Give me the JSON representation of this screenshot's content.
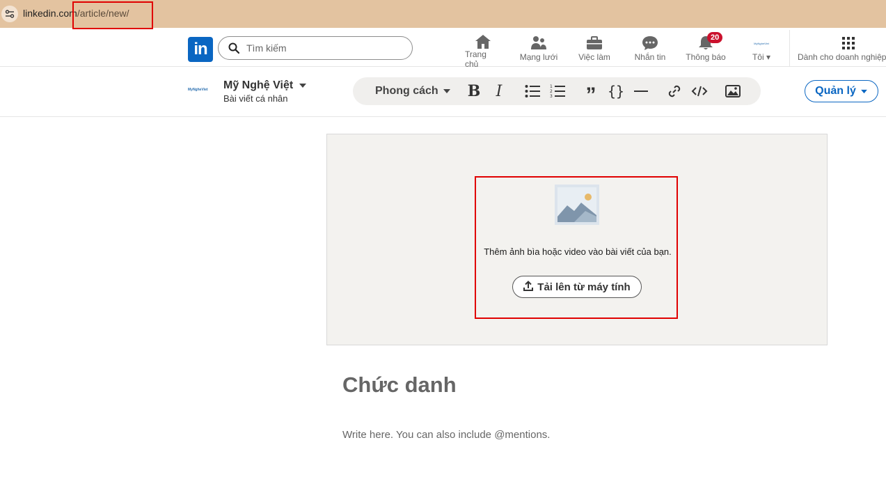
{
  "browser": {
    "url_host": "linkedin.com",
    "url_path": "/article/new/",
    "site_info_icon": "tune-icon"
  },
  "nav": {
    "logo_text": "in",
    "search_placeholder": "Tìm kiếm",
    "items": [
      {
        "label": "Trang chủ",
        "icon": "home-icon"
      },
      {
        "label": "Mạng lưới",
        "icon": "network-icon"
      },
      {
        "label": "Việc làm",
        "icon": "briefcase-icon"
      },
      {
        "label": "Nhắn tin",
        "icon": "message-icon"
      },
      {
        "label": "Thông báo",
        "icon": "bell-icon",
        "badge": "20"
      },
      {
        "label": "Tôi",
        "icon": "avatar-icon"
      },
      {
        "label": "Dành cho doanh nghiệp",
        "icon": "grid-icon"
      }
    ]
  },
  "editor": {
    "author_logo_text": "MyNgheViet",
    "author_name": "Mỹ Nghệ Việt",
    "author_sub": "Bài viết cá nhân",
    "style_label": "Phong cách",
    "manage_label": "Quản lý",
    "tools": [
      "bold-icon",
      "italic-icon",
      "bulleted-list-icon",
      "numbered-list-icon",
      "quote-icon",
      "code-braces-icon",
      "divider-icon",
      "link-icon",
      "code-block-icon",
      "image-icon"
    ]
  },
  "cover": {
    "prompt": "Thêm ảnh bìa hoặc video vào bài viết của bạn.",
    "upload_label": "Tải lên từ máy tính"
  },
  "article": {
    "title_placeholder": "Chức danh",
    "body_placeholder": "Write here. You can also include @mentions."
  },
  "colors": {
    "linkedin_blue": "#0a66c2",
    "badge_red": "#cb112d",
    "highlight_red": "#e00000",
    "addressbar": "#e3c3a0"
  }
}
